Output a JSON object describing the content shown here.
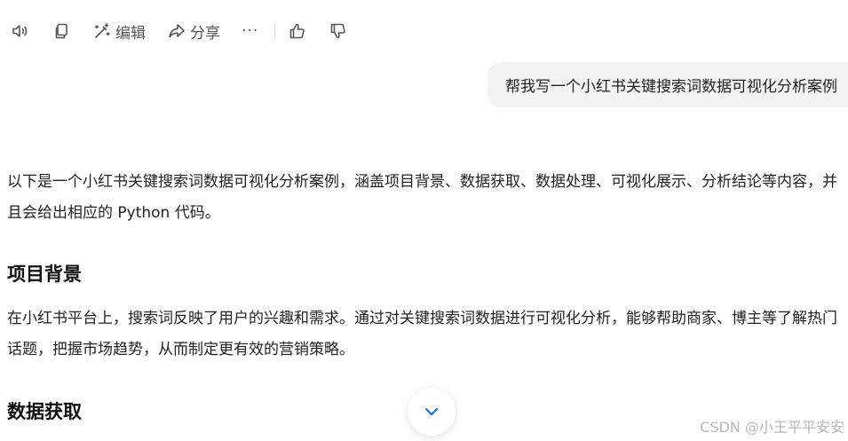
{
  "toolbar": {
    "edit_label": "编辑",
    "share_label": "分享",
    "more_label": "···"
  },
  "user_message": "帮我写一个小红书关键搜索词数据可视化分析案例",
  "answer": {
    "intro": "以下是一个小红书关键搜索词数据可视化分析案例，涵盖项目背景、数据获取、数据处理、可视化展示、分析结论等内容，并且会给出相应的 Python 代码。",
    "section1_title": "项目背景",
    "section1_body": "在小红书平台上，搜索词反映了用户的兴趣和需求。通过对关键搜索词数据进行可视化分析，能够帮助商家、博主等了解热门话题，把握市场趋势，从而制定更有效的营销策略。",
    "section2_title": "数据获取"
  },
  "watermark": "CSDN @小王平平安安",
  "colors": {
    "accent": "#1a6cf0",
    "bubble_bg": "#f2f2f2",
    "icon": "#555555"
  }
}
